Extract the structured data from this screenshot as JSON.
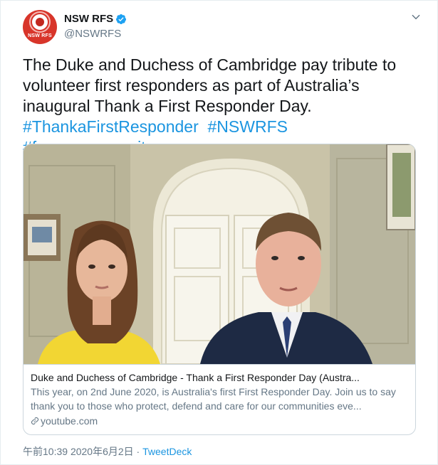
{
  "account": {
    "display_name": "NSW RFS",
    "handle": "@NSWRFS",
    "avatar_text": "NSW RFS",
    "verified": true
  },
  "tweet": {
    "text_plain": "The Duke and Duchess of Cambridge pay tribute to volunteer first responders as part of Australia’s inaugural Thank a First Responder Day.",
    "hashtags": [
      "#ThankaFirstResponder",
      "#NSWRFS",
      "#forourcommunity"
    ]
  },
  "card": {
    "title": "Duke and Duchess of Cambridge - Thank a First Responder Day (Austra...",
    "description": "This year, on 2nd June 2020, is Australia's first First Responder Day. Join us to say thank you to those who protect, defend and care for our communities eve...",
    "domain": "youtube.com"
  },
  "meta": {
    "time": "午前10:39",
    "separator": "·",
    "date": "2020年6月2日",
    "source": "TweetDeck"
  },
  "colors": {
    "link": "#1b95e0",
    "muted": "#657786",
    "brand_red": "#d8352a"
  },
  "icons": {
    "verified": "verified-badge-icon",
    "caret": "chevron-down-icon",
    "link": "link-icon"
  }
}
